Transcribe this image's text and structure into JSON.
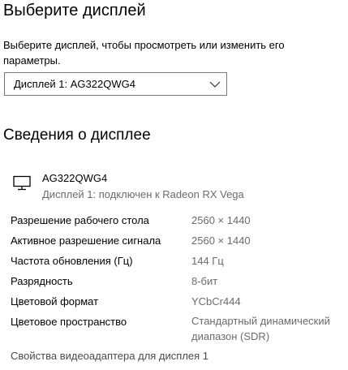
{
  "choose_display": {
    "title": "Выберите дисплей",
    "description": "Выберите дисплей, чтобы просмотреть или изменить его параметры.",
    "dropdown": {
      "selected": "Дисплей 1: AG322QWG4",
      "icon": "chevron-down-icon"
    }
  },
  "display_info": {
    "title": "Сведения о дисплее",
    "monitor": {
      "icon": "monitor-icon",
      "name": "AG322QWG4",
      "subtitle": "Дисплей 1: подключен к Radeon RX Vega"
    },
    "rows": [
      {
        "label": "Разрешение рабочего стола",
        "value": "2560 × 1440"
      },
      {
        "label": "Активное разрешение сигнала",
        "value": "2560 × 1440"
      },
      {
        "label": "Частота обновления (Гц)",
        "value": "144 Гц"
      },
      {
        "label": "Разрядность",
        "value": "8-бит"
      },
      {
        "label": "Цветовой формат",
        "value": "YCbCr444"
      },
      {
        "label": "Цветовое пространство",
        "value": "Стандартный динамический диапазон (SDR)"
      }
    ],
    "adapter_link": "Свойства видеоадаптера для дисплея 1"
  }
}
